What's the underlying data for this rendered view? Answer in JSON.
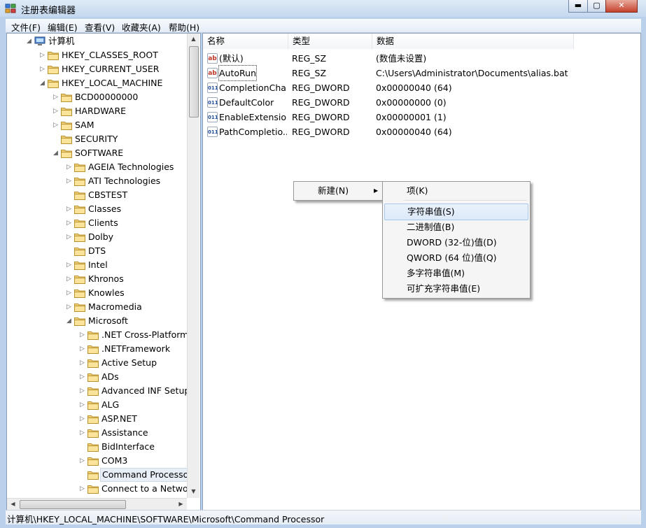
{
  "window": {
    "title": "注册表编辑器",
    "min_label": "▬",
    "max_label": "▢",
    "close_label": "✕"
  },
  "menu": [
    "文件(F)",
    "编辑(E)",
    "查看(V)",
    "收藏夹(A)",
    "帮助(H)"
  ],
  "tree": [
    {
      "label": "计算机",
      "arrow": "◢",
      "level": 0,
      "icon": "computer-icon"
    },
    {
      "label": "HKEY_CLASSES_ROOT",
      "arrow": "▷",
      "level": 1
    },
    {
      "label": "HKEY_CURRENT_USER",
      "arrow": "▷",
      "level": 1
    },
    {
      "label": "HKEY_LOCAL_MACHINE",
      "arrow": "◢",
      "level": 1
    },
    {
      "label": "BCD00000000",
      "arrow": "▷",
      "level": 2
    },
    {
      "label": "HARDWARE",
      "arrow": "▷",
      "level": 2
    },
    {
      "label": "SAM",
      "arrow": "▷",
      "level": 2
    },
    {
      "label": "SECURITY",
      "arrow": "",
      "level": 2
    },
    {
      "label": "SOFTWARE",
      "arrow": "◢",
      "level": 2
    },
    {
      "label": "AGEIA Technologies",
      "arrow": "▷",
      "level": 3
    },
    {
      "label": "ATI Technologies",
      "arrow": "▷",
      "level": 3
    },
    {
      "label": "CBSTEST",
      "arrow": "",
      "level": 3
    },
    {
      "label": "Classes",
      "arrow": "▷",
      "level": 3
    },
    {
      "label": "Clients",
      "arrow": "▷",
      "level": 3
    },
    {
      "label": "Dolby",
      "arrow": "▷",
      "level": 3
    },
    {
      "label": "DTS",
      "arrow": "",
      "level": 3
    },
    {
      "label": "Intel",
      "arrow": "▷",
      "level": 3
    },
    {
      "label": "Khronos",
      "arrow": "▷",
      "level": 3
    },
    {
      "label": "Knowles",
      "arrow": "▷",
      "level": 3
    },
    {
      "label": "Macromedia",
      "arrow": "▷",
      "level": 3
    },
    {
      "label": "Microsoft",
      "arrow": "◢",
      "level": 3
    },
    {
      "label": ".NET Cross-Platform",
      "arrow": "▷",
      "level": 4
    },
    {
      "label": ".NETFramework",
      "arrow": "▷",
      "level": 4
    },
    {
      "label": "Active Setup",
      "arrow": "▷",
      "level": 4
    },
    {
      "label": "ADs",
      "arrow": "▷",
      "level": 4
    },
    {
      "label": "Advanced INF Setup",
      "arrow": "▷",
      "level": 4
    },
    {
      "label": "ALG",
      "arrow": "▷",
      "level": 4
    },
    {
      "label": "ASP.NET",
      "arrow": "▷",
      "level": 4
    },
    {
      "label": "Assistance",
      "arrow": "▷",
      "level": 4
    },
    {
      "label": "BidInterface",
      "arrow": "",
      "level": 4
    },
    {
      "label": "COM3",
      "arrow": "▷",
      "level": 4
    },
    {
      "label": "Command Processor",
      "arrow": "",
      "level": 4,
      "selected": true
    },
    {
      "label": "Connect to a Network F",
      "arrow": "▷",
      "level": 4
    }
  ],
  "list": {
    "columns": [
      "名称",
      "类型",
      "数据"
    ],
    "rows": [
      {
        "name": "(默认)",
        "type": "REG_SZ",
        "data": "(数值未设置)",
        "icon": "ab"
      },
      {
        "name": "AutoRun",
        "type": "REG_SZ",
        "data": "C:\\Users\\Administrator\\Documents\\alias.bat",
        "icon": "ab"
      },
      {
        "name": "CompletionChar",
        "type": "REG_DWORD",
        "data": "0x00000040 (64)",
        "icon": "011"
      },
      {
        "name": "DefaultColor",
        "type": "REG_DWORD",
        "data": "0x00000000 (0)",
        "icon": "011"
      },
      {
        "name": "EnableExtensio...",
        "type": "REG_DWORD",
        "data": "0x00000001 (1)",
        "icon": "011"
      },
      {
        "name": "PathCompletio...",
        "type": "REG_DWORD",
        "data": "0x00000040 (64)",
        "icon": "011"
      }
    ]
  },
  "context_menu": {
    "new_label": "新建(N)",
    "submenu_arrow": "▶",
    "submenu": [
      "项(K)",
      "字符串值(S)",
      "二进制值(B)",
      "DWORD (32-位)值(D)",
      "QWORD (64 位)值(Q)",
      "多字符串值(M)",
      "可扩充字符串值(E)"
    ]
  },
  "scroll": {
    "up": "▲",
    "down": "▼",
    "left": "◀",
    "right": "▶"
  },
  "status": "计算机\\HKEY_LOCAL_MACHINE\\SOFTWARE\\Microsoft\\Command Processor"
}
